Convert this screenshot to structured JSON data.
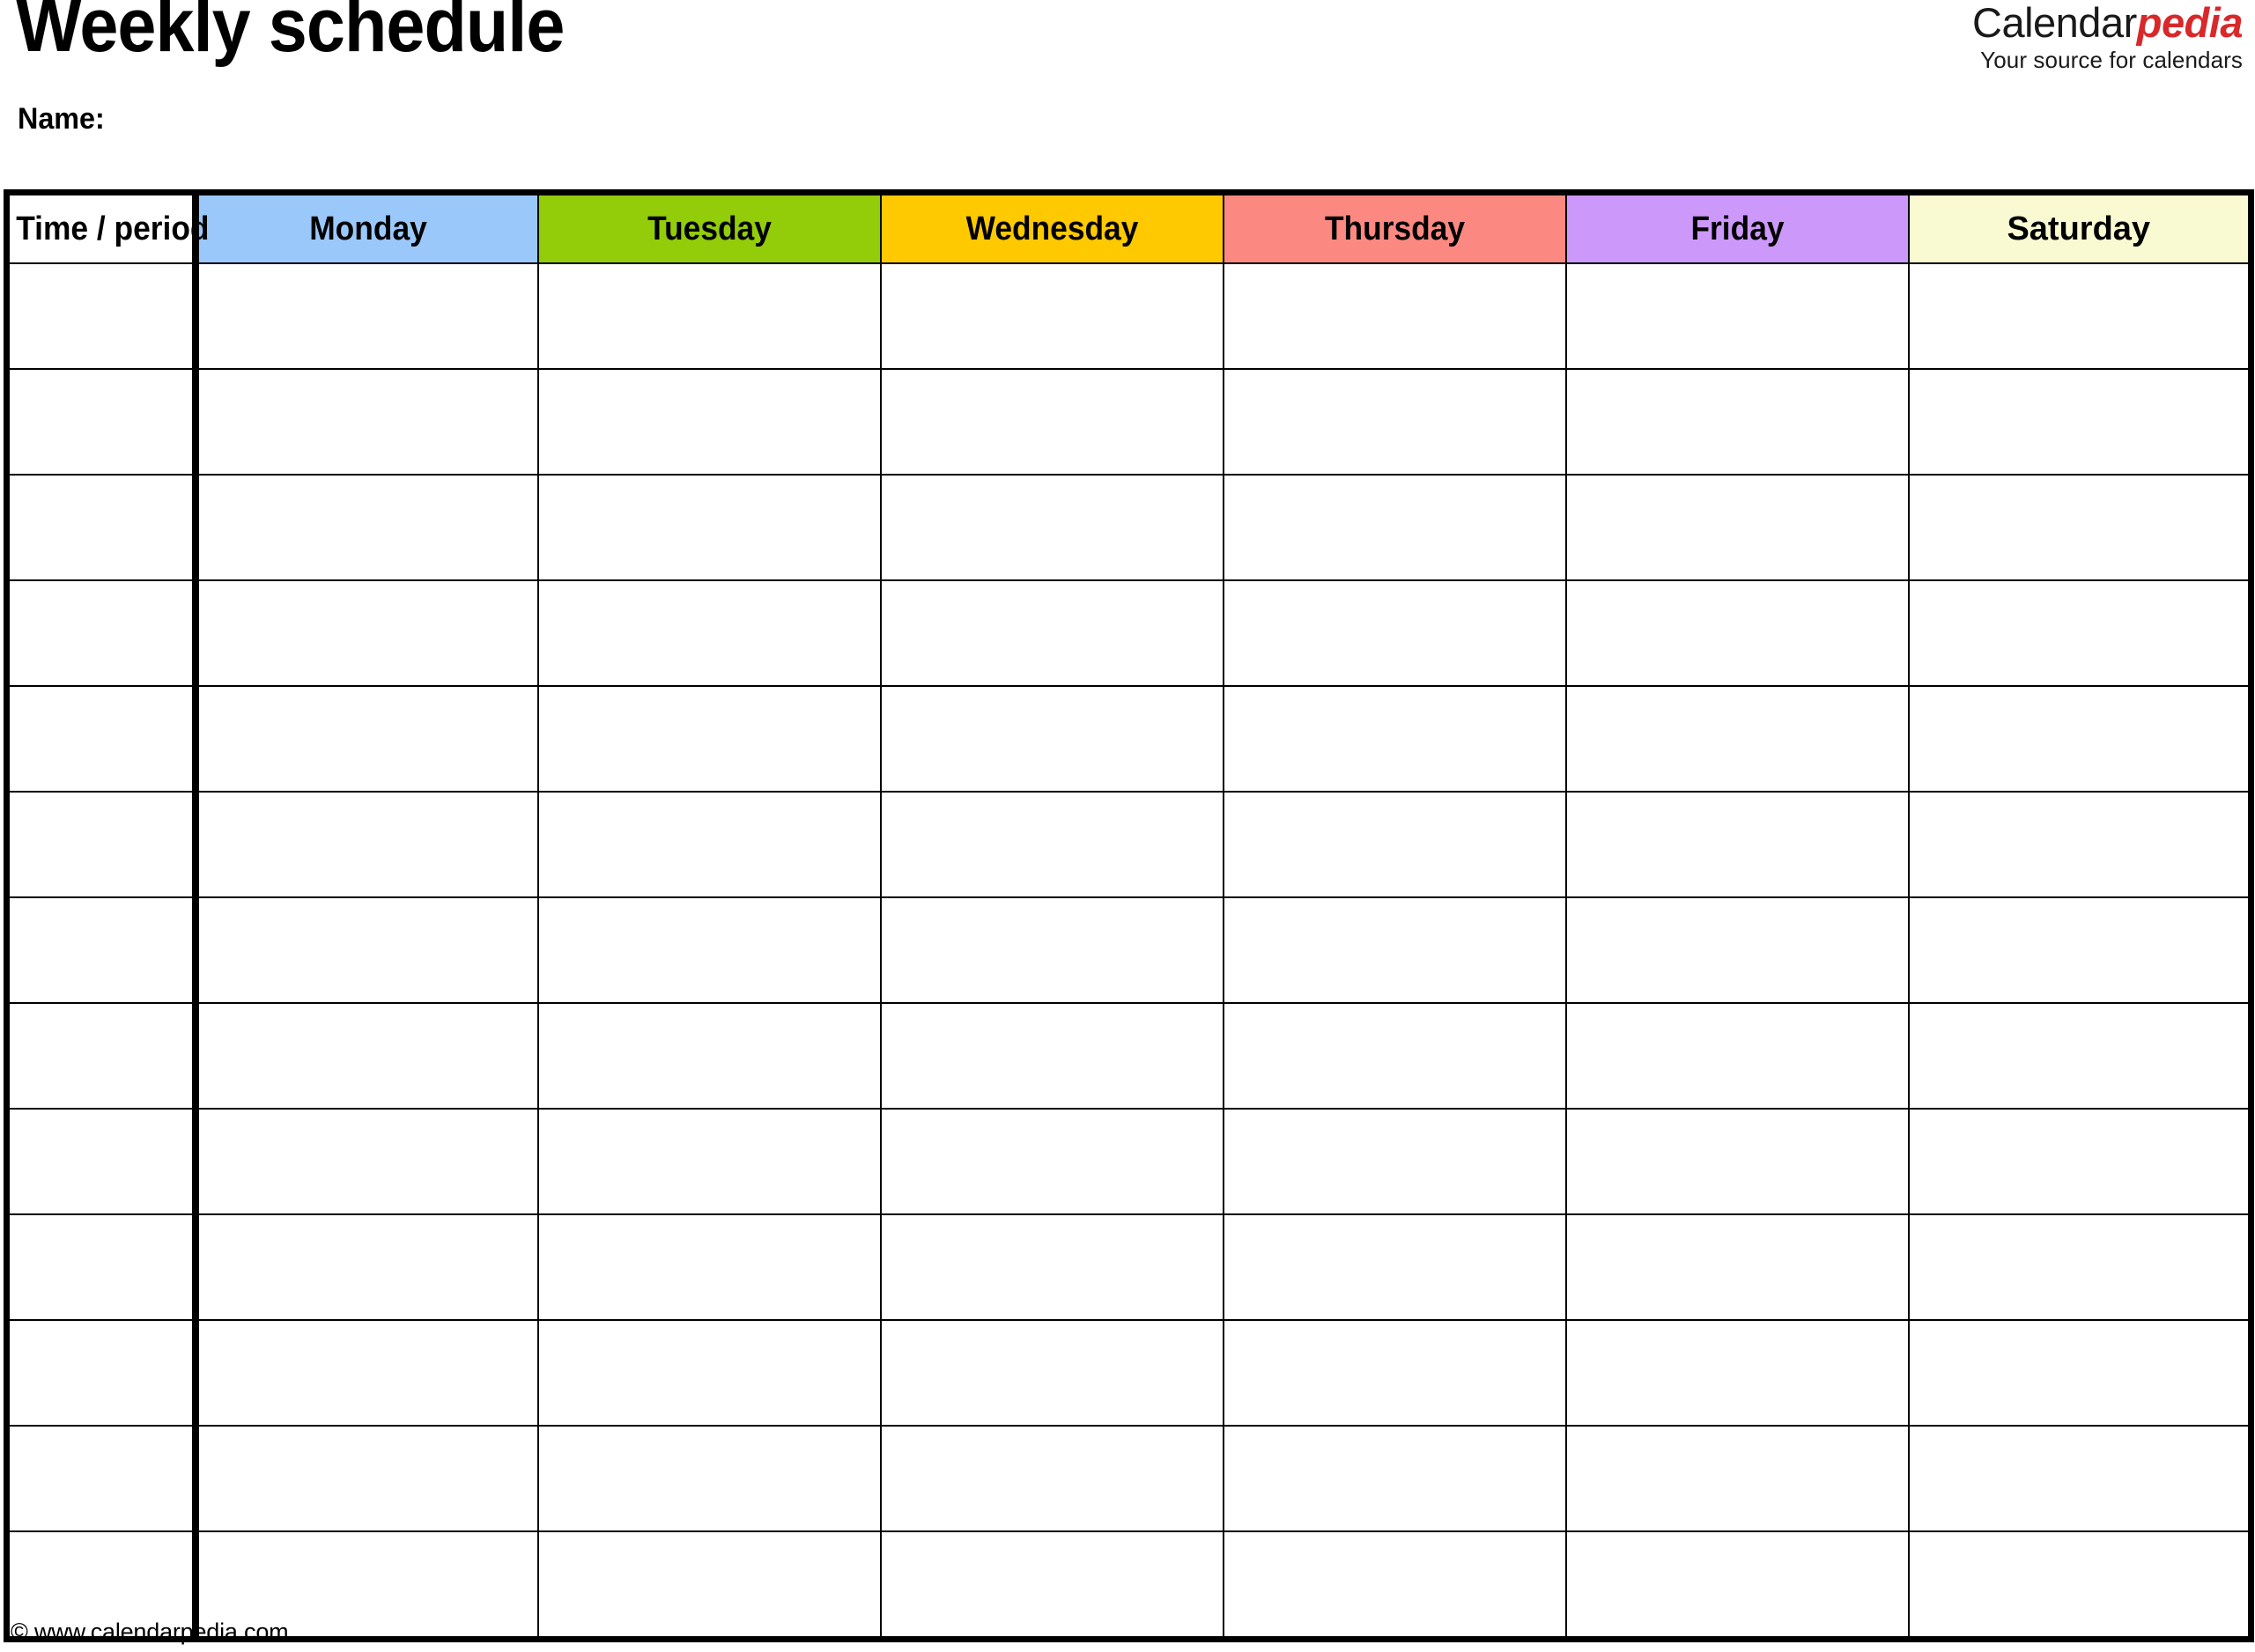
{
  "document": {
    "title": "Weekly schedule",
    "name_label": "Name:",
    "footer": "© www.calendarpedia.com"
  },
  "brand": {
    "word_primary": "Calendar",
    "word_accent": "pedia",
    "tagline": "Your source for calendars",
    "accent_color": "#D8282A",
    "primary_color": "#1a1a1a"
  },
  "schedule": {
    "columns": [
      {
        "label": "Time / period",
        "color": "#FFFFFF",
        "key": "time"
      },
      {
        "label": "Monday",
        "color": "#9AC8FA",
        "key": "monday"
      },
      {
        "label": "Tuesday",
        "color": "#93CC08",
        "key": "tuesday"
      },
      {
        "label": "Wednesday",
        "color": "#FFC900",
        "key": "wednesday"
      },
      {
        "label": "Thursday",
        "color": "#FC8981",
        "key": "thursday"
      },
      {
        "label": "Friday",
        "color": "#CC99FB",
        "key": "friday"
      },
      {
        "label": "Saturday",
        "color": "#FAFAD2",
        "key": "saturday"
      }
    ],
    "row_count": 13,
    "rows": [
      [
        "",
        "",
        "",
        "",
        "",
        "",
        ""
      ],
      [
        "",
        "",
        "",
        "",
        "",
        "",
        ""
      ],
      [
        "",
        "",
        "",
        "",
        "",
        "",
        ""
      ],
      [
        "",
        "",
        "",
        "",
        "",
        "",
        ""
      ],
      [
        "",
        "",
        "",
        "",
        "",
        "",
        ""
      ],
      [
        "",
        "",
        "",
        "",
        "",
        "",
        ""
      ],
      [
        "",
        "",
        "",
        "",
        "",
        "",
        ""
      ],
      [
        "",
        "",
        "",
        "",
        "",
        "",
        ""
      ],
      [
        "",
        "",
        "",
        "",
        "",
        "",
        ""
      ],
      [
        "",
        "",
        "",
        "",
        "",
        "",
        ""
      ],
      [
        "",
        "",
        "",
        "",
        "",
        "",
        ""
      ],
      [
        "",
        "",
        "",
        "",
        "",
        "",
        ""
      ],
      [
        "",
        "",
        "",
        "",
        "",
        "",
        ""
      ]
    ]
  }
}
